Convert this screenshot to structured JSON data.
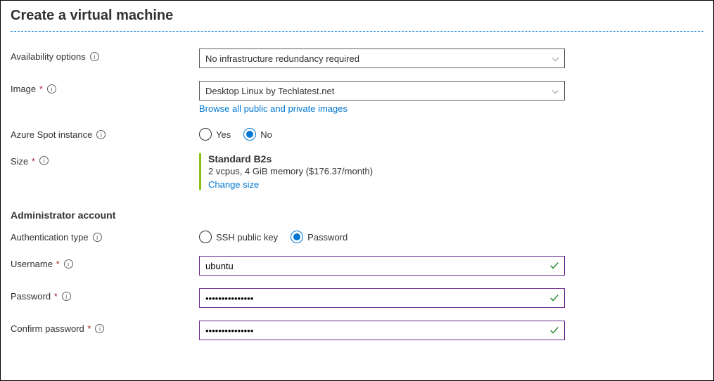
{
  "page": {
    "title": "Create a virtual machine"
  },
  "fields": {
    "availability": {
      "label": "Availability options",
      "value": "No infrastructure redundancy required"
    },
    "image": {
      "label": "Image",
      "value": "Desktop Linux by Techlatest.net",
      "link": "Browse all public and private images"
    },
    "spot": {
      "label": "Azure Spot instance",
      "optYes": "Yes",
      "optNo": "No"
    },
    "size": {
      "label": "Size",
      "name": "Standard B2s",
      "desc": "2 vcpus, 4 GiB memory ($176.37/month)",
      "link": "Change size"
    }
  },
  "section": {
    "admin": "Administrator account"
  },
  "admin": {
    "authType": {
      "label": "Authentication type",
      "optSSH": "SSH public key",
      "optPassword": "Password"
    },
    "username": {
      "label": "Username",
      "value": "ubuntu"
    },
    "password": {
      "label": "Password",
      "value": "•••••••••••••••"
    },
    "confirm": {
      "label": "Confirm password",
      "value": "•••••••••••••••"
    }
  }
}
